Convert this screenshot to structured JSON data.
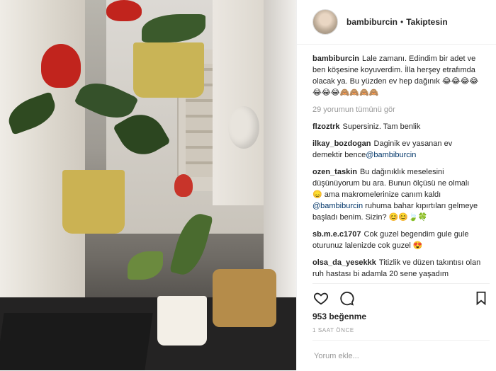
{
  "post": {
    "author": "bambiburcin",
    "follow_status": "Takiptesin",
    "separator": "•"
  },
  "caption": {
    "user": "bambiburcin",
    "text": "Lale zamanı. Edindim bir adet ve ben köşesine koyuverdim. İlla herşey etrafımda olacak ya. Bu yüzden ev hep dağınık",
    "emojis": "😂😂😂😂😂😂😂🙈🙈🙈🙈"
  },
  "view_all_comments": "29 yorumun tümünü gör",
  "comments": [
    {
      "user": "flzoztrk",
      "text": "Supersiniz. Tam benlik"
    },
    {
      "user": "ilkay_bozdogan",
      "text": "Daginik ev yasanan ev demektir bence",
      "mention": "@bambiburcin",
      "after": ""
    },
    {
      "user": "ozen_taskin",
      "text": "Bu dağınıklık meselesini düşünüyorum bu ara. Bunun ölçüsü ne olmalı 😞 ama makromelerinize canım kaldı ",
      "mention": "@bambiburcin",
      "after": " ruhuma bahar kıpırtıları gelmeye başladı benim. Sizin? 😊😊🍃🍀"
    },
    {
      "user": "sb.m.e.c1707",
      "text": "Cok guzel begendim gule gule oturunuz lalenizde cok guzel 😍"
    },
    {
      "user": "olsa_da_yesekkk",
      "text": "Titizlik ve düzen takıntısı olan ruh hastası bi adamla 20 sene yaşadım"
    }
  ],
  "likes": "953 beğenme",
  "time_ago": "1 SAAT ÖNCE",
  "comment_input": {
    "placeholder": "Yorum ekle..."
  },
  "icons": [
    "heart-icon",
    "comment-icon",
    "bookmark-icon"
  ]
}
